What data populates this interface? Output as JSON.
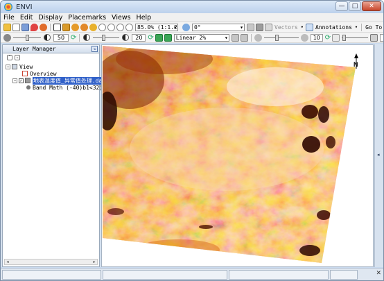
{
  "window": {
    "title": "ENVI",
    "minimize_label": "—",
    "maximize_label": "□",
    "close_label": "✕"
  },
  "menu": [
    "File",
    "Edit",
    "Display",
    "Placemarks",
    "Views",
    "Help"
  ],
  "toolbar1": {
    "zoom_value": "85.0% (1:1.2)",
    "rotation_value": "0°",
    "vectors_label": "Vectors",
    "annotations_label": "Annotations",
    "goto_label": "Go To"
  },
  "toolbar2": {
    "brightness_value": "50",
    "contrast_value": "20",
    "stretch_value": "Linear 2%",
    "sharpen_value": "10",
    "transparency_value": "0",
    "brightness_level": 0.5,
    "contrast_level": 0.4,
    "sharpen_level": 0.35,
    "transparency_level": 0.02
  },
  "layer_manager": {
    "title": "Layer Manager",
    "pin_icon": "pin-icon",
    "tree": {
      "view_label": "View",
      "overview_label": "Overview",
      "file_label": "地表温度值_异常值处理.dat",
      "band_label": "Band Math (-40)b1<32)"
    }
  },
  "image_view": {
    "north_arrow_label": "N",
    "colormap": [
      "#2a0a00",
      "#6b1c00",
      "#b83a00",
      "#e06a10",
      "#f5a041",
      "#fcd08f",
      "#fff4e2"
    ]
  },
  "colors": {
    "selection": "#3161c9",
    "titlebar": "#c9daef",
    "panel_border": "#9aa9bb"
  }
}
